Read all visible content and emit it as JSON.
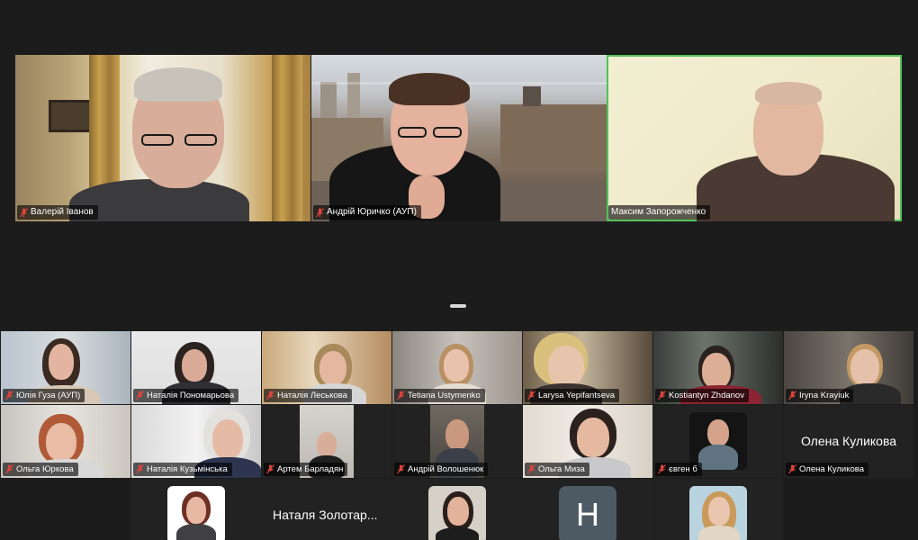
{
  "speakers": [
    {
      "name": "Валерій Іванов",
      "muted": true,
      "active": false
    },
    {
      "name": "Андрій Юричко (АУП)",
      "muted": true,
      "active": false
    },
    {
      "name": "Максим Запорожченко",
      "muted": false,
      "active": true
    }
  ],
  "gallery": {
    "row1": [
      {
        "name": "Юлія Гуза (АУП)",
        "muted": true
      },
      {
        "name": "Наталія Пономарьова",
        "muted": true
      },
      {
        "name": "Наталія Леськова",
        "muted": true
      },
      {
        "name": "Tetiana Ustymenko",
        "muted": true
      },
      {
        "name": "Larysa Yepifantseva",
        "muted": true
      },
      {
        "name": "Kostiantyn Zhdanov",
        "muted": true
      },
      {
        "name": "Iryna Krayiuk",
        "muted": true
      }
    ],
    "row2": [
      {
        "name": "Ольга Юркова",
        "muted": true
      },
      {
        "name": "Наталія Кузьмінська",
        "muted": true
      },
      {
        "name": "Артем Барладян",
        "muted": true
      },
      {
        "name": "Андрій Волошенюк",
        "muted": true
      },
      {
        "name": "Ольга Миза",
        "muted": true
      },
      {
        "name": "євген б",
        "muted": true
      },
      {
        "name": "Олена Куликова",
        "muted": true,
        "display_name_large": "Олена Куликова"
      }
    ],
    "row3": [
      {
        "name": "",
        "muted": true
      },
      {
        "name": "",
        "muted": true,
        "display_name_large": "Наталя Золотар..."
      },
      {
        "name": "",
        "muted": true
      },
      {
        "name": "",
        "muted": true,
        "avatar_letter": "H"
      },
      {
        "name": "",
        "muted": true
      }
    ]
  },
  "colors": {
    "background": "#1c1c1c",
    "active_speaker_border": "#52c35a",
    "muted_icon": "#e0443e",
    "name_tag_bg": "rgba(0,0,0,0.62)"
  },
  "icons": {
    "muted": "microphone-muted-icon",
    "drag_handle": "panel-resize-handle-icon"
  }
}
